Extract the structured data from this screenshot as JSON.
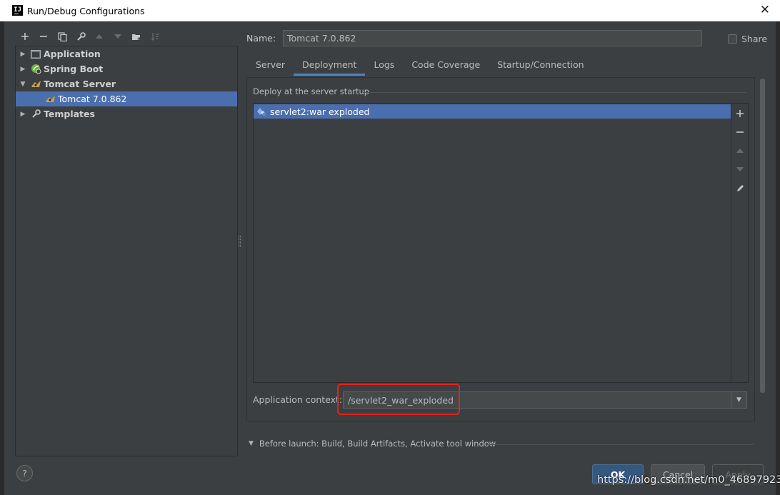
{
  "window": {
    "title": "Run/Debug Configurations",
    "app_icon_text": "IJ",
    "close_glyph": "✕"
  },
  "left_toolbar": {
    "icons": [
      "add-icon",
      "remove-icon",
      "copy-icon",
      "wrench-icon",
      "move-up-icon",
      "move-down-icon",
      "new-folder-icon",
      "sort-icon"
    ]
  },
  "tree": {
    "items": [
      {
        "label": "Application",
        "icon": "application-icon",
        "expanded": false
      },
      {
        "label": "Spring Boot",
        "icon": "spring-boot-icon",
        "expanded": false
      },
      {
        "label": "Tomcat Server",
        "icon": "tomcat-icon",
        "expanded": true
      },
      {
        "label": "Tomcat 7.0.862",
        "icon": "tomcat-icon",
        "selected": true
      },
      {
        "label": "Templates",
        "icon": "wrench-icon",
        "expanded": false
      }
    ]
  },
  "name_row": {
    "label": "Name:",
    "value": "Tomcat 7.0.862",
    "share_label": "Share",
    "share_checked": false
  },
  "tabs": [
    {
      "label": "Server",
      "active": false
    },
    {
      "label": "Deployment",
      "active": true
    },
    {
      "label": "Logs",
      "active": false
    },
    {
      "label": "Code Coverage",
      "active": false
    },
    {
      "label": "Startup/Connection",
      "active": false
    }
  ],
  "deployment": {
    "group_label": "Deploy at the server startup",
    "items": [
      {
        "label": "servlet2:war exploded",
        "icon": "artifact-icon"
      }
    ],
    "side_tools": [
      "add-icon",
      "remove-icon",
      "move-up-icon",
      "move-down-icon",
      "edit-icon"
    ],
    "app_context_label": "Application context:",
    "app_context_value": "/servlet2_war_exploded",
    "highlight_color": "#e8201b"
  },
  "before_launch": {
    "text": "Before launch: Build, Build Artifacts, Activate tool window"
  },
  "buttons": {
    "help": "?",
    "ok": "OK",
    "cancel": "Cancel",
    "apply": "Apply"
  },
  "watermark": "https://blog.csdn.net/m0_46897923",
  "colors": {
    "background": "#3c3f41",
    "selection": "#4b6eaf",
    "tab_underline": "#4a88c7",
    "ok_button": "#365880"
  }
}
